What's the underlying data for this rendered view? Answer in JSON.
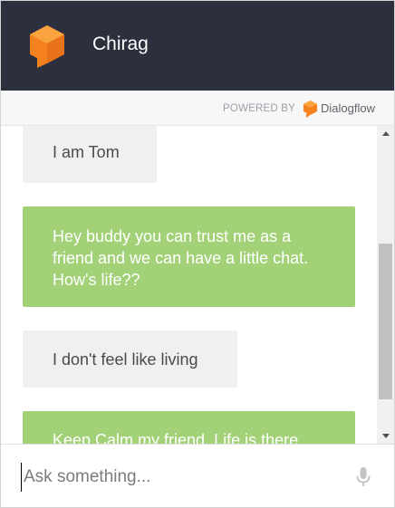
{
  "header": {
    "bot_name": "Chirag",
    "logo_icon": "dialogflow-agent-icon",
    "background": "#2b2f3e"
  },
  "powered_by": {
    "label": "POWERED BY",
    "brand": "Dialogflow",
    "brand_icon": "dialogflow-icon"
  },
  "messages": [
    {
      "from": "bot",
      "text": "I am Tom"
    },
    {
      "from": "user",
      "text": "Hey buddy you can trust me as a friend and we can have a little chat. How's life??"
    },
    {
      "from": "bot",
      "text": "I don't feel like living"
    },
    {
      "from": "user",
      "text": "Keep Calm my friend, Life is there"
    }
  ],
  "input": {
    "placeholder": "Ask something...",
    "value": "",
    "mic_icon": "microphone-icon"
  },
  "colors": {
    "user_bubble": "#a3d177",
    "bot_bubble": "#f0f0f0",
    "accent_orange": "#f5821f"
  }
}
